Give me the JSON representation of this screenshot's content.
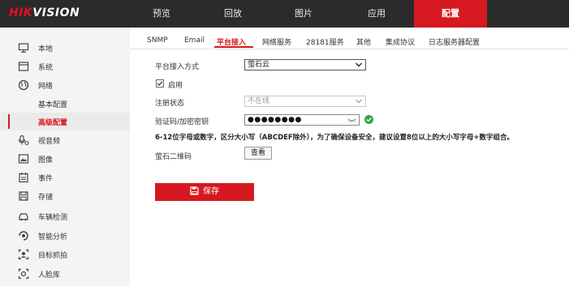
{
  "brand": {
    "logo_red": "HIK",
    "logo_white": "VISION"
  },
  "topnav": {
    "items": [
      {
        "label": "预览"
      },
      {
        "label": "回放"
      },
      {
        "label": "图片"
      },
      {
        "label": "应用"
      },
      {
        "label": "配置",
        "active": true
      }
    ]
  },
  "sidebar": {
    "items": [
      {
        "label": "本地",
        "icon": "monitor-icon"
      },
      {
        "label": "系统",
        "icon": "system-icon"
      },
      {
        "label": "网络",
        "icon": "globe-icon"
      },
      {
        "label": "基本配置",
        "sub": true
      },
      {
        "label": "高级配置",
        "sub": true,
        "active": true
      },
      {
        "label": "视音频",
        "icon": "av-icon"
      },
      {
        "label": "图像",
        "icon": "image-icon"
      },
      {
        "label": "事件",
        "icon": "calendar-icon"
      },
      {
        "label": "存储",
        "icon": "storage-icon"
      },
      {
        "label": "车辆检测",
        "icon": "vehicle-icon"
      },
      {
        "label": "智能分析",
        "icon": "analysis-icon"
      },
      {
        "label": "目标抓拍",
        "icon": "capture-icon"
      },
      {
        "label": "人脸库",
        "icon": "face-icon"
      }
    ]
  },
  "tabs": {
    "items": [
      {
        "label": "SNMP"
      },
      {
        "label": "Email"
      },
      {
        "label": "平台接入",
        "active": true
      },
      {
        "label": "网络服务"
      },
      {
        "label": "28181服务"
      },
      {
        "label": "其他"
      },
      {
        "label": "集成协议"
      },
      {
        "label": "日志服务器配置"
      }
    ]
  },
  "form": {
    "access_mode_label": "平台接入方式",
    "access_mode_value": "萤石云",
    "enable_label": "启用",
    "enable_checked": true,
    "register_status_label": "注册状态",
    "register_status_value": "不在线",
    "verify_code_label": "验证码/加密密钥",
    "verify_code_value": "●●●●●●●●",
    "password_hint": "6-12位字母或数字，区分大小写（ABCDEF除外），为了确保设备安全，建议设置8位以上的大小写字母+数字组合。",
    "qr_label": "萤石二维码",
    "qr_button": "查看",
    "save_button": "保存"
  },
  "colors": {
    "accent": "#d61920",
    "topbar": "#2b2b2b",
    "sidebar": "#f4f4f4",
    "valid": "#2aa84a"
  }
}
